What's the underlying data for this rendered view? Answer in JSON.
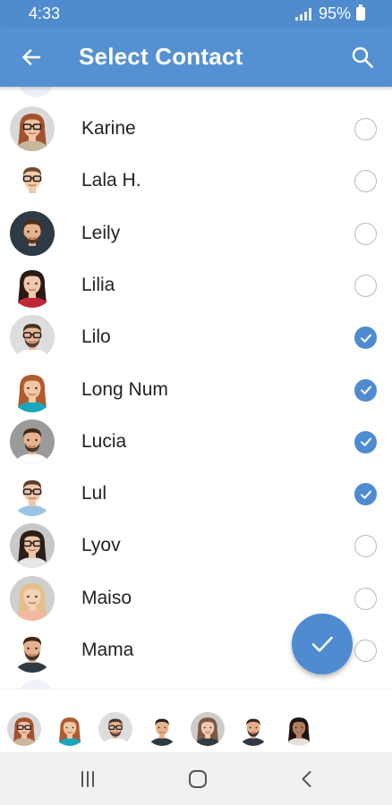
{
  "status_bar": {
    "time": "4:33",
    "battery": "95%"
  },
  "app_bar": {
    "title": "Select Contact",
    "back_icon": "arrow-left-icon",
    "search_icon": "search-icon"
  },
  "colors": {
    "primary": "#5591d2",
    "accent": "#4f8bd1",
    "status_bar": "#4f8bcd"
  },
  "contacts": [
    {
      "name": "Karine",
      "selected": false,
      "avatar": {
        "skin": "#f2c3a5",
        "hair": "#a2532e",
        "bg": "#d9d9d9",
        "shirt": "#c9b79b",
        "glasses": true,
        "beard": false,
        "long_hair": true
      }
    },
    {
      "name": "Lala H.",
      "selected": false,
      "avatar": {
        "skin": "#f3c9a8",
        "hair": "#6e4a2e",
        "bg": "#ffffff",
        "shirt": "#ffffff",
        "glasses": true,
        "beard": false,
        "long_hair": false
      }
    },
    {
      "name": "Leily",
      "selected": false,
      "avatar": {
        "skin": "#e7b18c",
        "hair": "#4a2d1a",
        "bg": "#2e3b46",
        "shirt": "#2c3a46",
        "glasses": false,
        "beard": true,
        "long_hair": false
      }
    },
    {
      "name": "Lilia",
      "selected": false,
      "avatar": {
        "skin": "#f1c8ad",
        "hair": "#2a1a14",
        "bg": "#ffffff",
        "shirt": "#c0283a",
        "glasses": false,
        "beard": false,
        "long_hair": true
      }
    },
    {
      "name": "Lilo",
      "selected": true,
      "avatar": {
        "skin": "#eab695",
        "hair": "#4a3326",
        "bg": "#dddddd",
        "shirt": "#ffffff",
        "glasses": true,
        "beard": true,
        "long_hair": false
      }
    },
    {
      "name": "Long Num",
      "selected": true,
      "avatar": {
        "skin": "#f3c6a4",
        "hair": "#b05a30",
        "bg": "#ffffff",
        "shirt": "#1aa6b8",
        "glasses": false,
        "beard": false,
        "long_hair": true
      }
    },
    {
      "name": "Lucia",
      "selected": true,
      "avatar": {
        "skin": "#e8b28f",
        "hair": "#3d2a1e",
        "bg": "#9a9a9a",
        "shirt": "#ffffff",
        "glasses": false,
        "beard": true,
        "long_hair": false
      }
    },
    {
      "name": "Lul",
      "selected": true,
      "avatar": {
        "skin": "#f2c7a9",
        "hair": "#5a3c28",
        "bg": "#ffffff",
        "shirt": "#9bc3e6",
        "glasses": true,
        "beard": false,
        "long_hair": false
      }
    },
    {
      "name": "Lyov",
      "selected": false,
      "avatar": {
        "skin": "#f0c3a1",
        "hair": "#2a1e18",
        "bg": "#c8c8c8",
        "shirt": "#e6e6e6",
        "glasses": true,
        "beard": false,
        "long_hair": true
      }
    },
    {
      "name": "Maiso",
      "selected": false,
      "avatar": {
        "skin": "#f4d0b4",
        "hair": "#e3c08b",
        "bg": "#cfcfcf",
        "shirt": "#f3b9a0",
        "glasses": false,
        "beard": false,
        "long_hair": true
      }
    },
    {
      "name": "Mama",
      "selected": false,
      "avatar": {
        "skin": "#e6b08d",
        "hair": "#3a2519",
        "bg": "#ffffff",
        "shirt": "#2f3a44",
        "glasses": false,
        "beard": true,
        "long_hair": false
      }
    }
  ],
  "selected_strip": [
    {
      "skin": "#f2c3a5",
      "hair": "#a2532e",
      "bg": "#d9d9d9",
      "shirt": "#c9b79b",
      "glasses": true,
      "beard": false,
      "long_hair": true
    },
    {
      "skin": "#f3c6a4",
      "hair": "#b05a30",
      "bg": "#ffffff",
      "shirt": "#1aa6b8",
      "glasses": false,
      "beard": false,
      "long_hair": true
    },
    {
      "skin": "#eab695",
      "hair": "#4a3326",
      "bg": "#dddddd",
      "shirt": "#ffffff",
      "glasses": true,
      "beard": true,
      "long_hair": false
    },
    {
      "skin": "#e7b18c",
      "hair": "#222222",
      "bg": "#ffffff",
      "shirt": "#2c3a46",
      "glasses": false,
      "beard": false,
      "long_hair": false
    },
    {
      "skin": "#f1c8ad",
      "hair": "#7a5a44",
      "bg": "#cccccc",
      "shirt": "#2f3a44",
      "glasses": false,
      "beard": false,
      "long_hair": true
    },
    {
      "skin": "#e6b08d",
      "hair": "#3a2519",
      "bg": "#ffffff",
      "shirt": "#2f3a44",
      "glasses": false,
      "beard": true,
      "long_hair": false
    },
    {
      "skin": "#b47e5e",
      "hair": "#1e1410",
      "bg": "#ffffff",
      "shirt": "#e6e0d8",
      "glasses": false,
      "beard": false,
      "long_hair": true
    }
  ],
  "fab": {
    "icon": "checkmark-icon"
  },
  "nav_bar": {
    "recent_icon": "recent-apps-icon",
    "home_icon": "home-icon",
    "back_icon": "back-chevron-icon"
  }
}
